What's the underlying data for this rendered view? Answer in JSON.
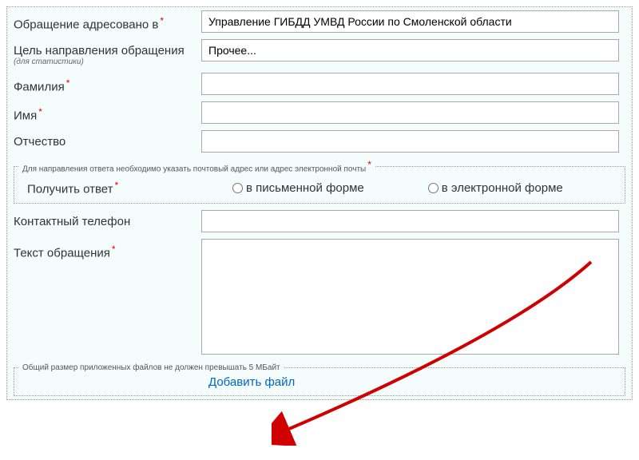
{
  "fields": {
    "addressed_to": {
      "label": "Обращение адресовано в",
      "value": "Управление ГИБДД УМВД России по Смоленской области",
      "required": true
    },
    "purpose": {
      "label": "Цель направления обращения",
      "hint": "(для статистики)",
      "value": "Прочее...",
      "required": false
    },
    "lastname": {
      "label": "Фамилия",
      "value": "",
      "required": true
    },
    "firstname": {
      "label": "Имя",
      "value": "",
      "required": true
    },
    "patronymic": {
      "label": "Отчество",
      "value": "",
      "required": false
    }
  },
  "response_section": {
    "legend": "Для направления ответа необходимо указать почтовый адрес или адрес электронной почты",
    "label": "Получить ответ",
    "required": true,
    "options": {
      "written": "в письменной форме",
      "electronic": "в электронной форме"
    }
  },
  "contact_phone": {
    "label": "Контактный телефон",
    "value": ""
  },
  "message_text": {
    "label": "Текст обращения",
    "value": "",
    "required": true
  },
  "file_section": {
    "legend": "Общий размер приложенных файлов не должен превышать 5 МБайт",
    "add_file_label": "Добавить файл"
  },
  "asterisk": "*"
}
